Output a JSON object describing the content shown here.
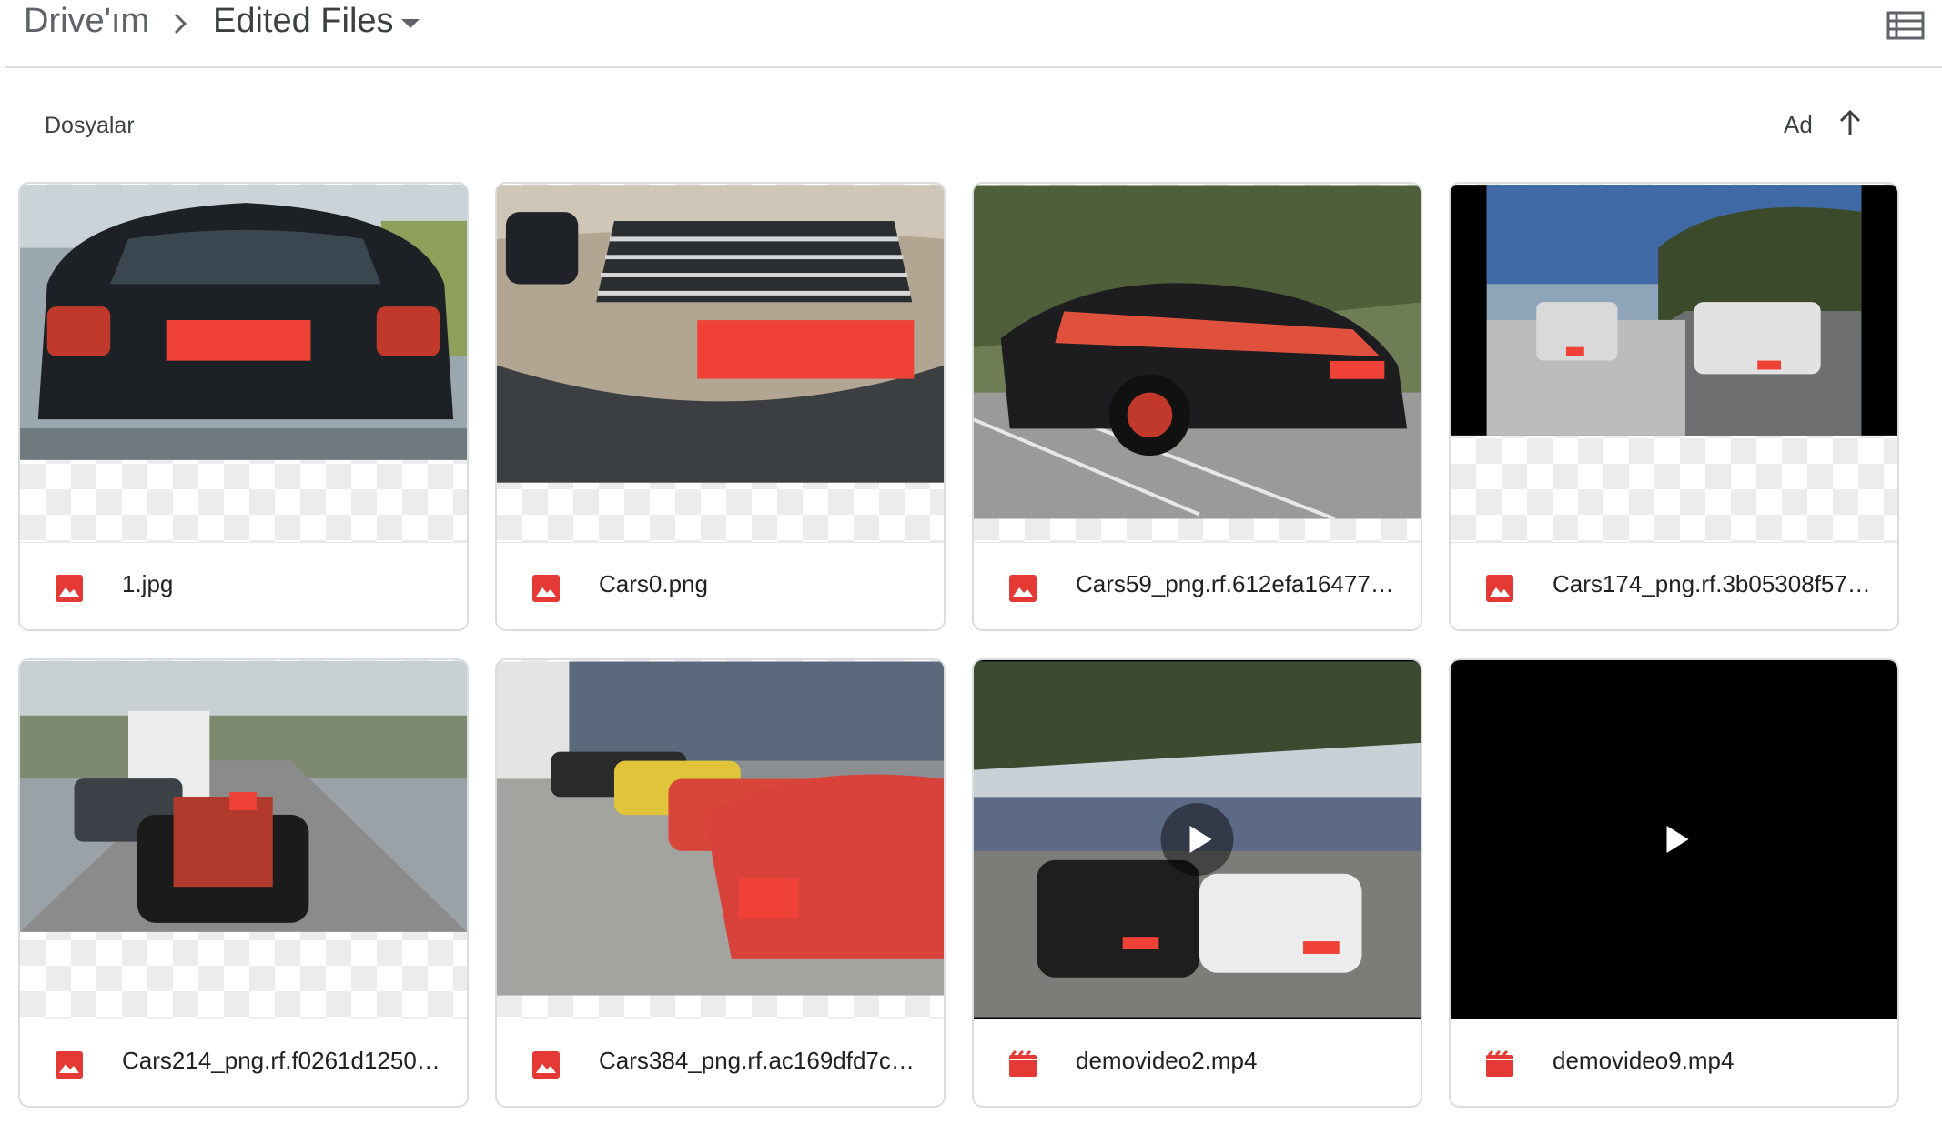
{
  "breadcrumb": {
    "root": "Drive'ım",
    "current": "Edited Files"
  },
  "toolbar": {
    "view_icon": "list-view-icon"
  },
  "section": {
    "label": "Dosyalar"
  },
  "sort": {
    "label": "Ad",
    "direction_icon": "arrow-up-icon"
  },
  "colors": {
    "image_icon": "#e53935",
    "video_icon": "#e53935",
    "redaction": "#ef4136"
  },
  "files": [
    {
      "name": "1.jpg",
      "type": "image",
      "type_icon": "image-icon"
    },
    {
      "name": "Cars0.png",
      "type": "image",
      "type_icon": "image-icon"
    },
    {
      "name": "Cars59_png.rf.612efa16477…",
      "type": "image",
      "type_icon": "image-icon"
    },
    {
      "name": "Cars174_png.rf.3b05308f57…",
      "type": "image",
      "type_icon": "image-icon"
    },
    {
      "name": "Cars214_png.rf.f0261d1250…",
      "type": "image",
      "type_icon": "image-icon"
    },
    {
      "name": "Cars384_png.rf.ac169dfd7c…",
      "type": "image",
      "type_icon": "image-icon"
    },
    {
      "name": "demovideo2.mp4",
      "type": "video",
      "type_icon": "video-icon"
    },
    {
      "name": "demovideo9.mp4",
      "type": "video",
      "type_icon": "video-icon"
    }
  ]
}
